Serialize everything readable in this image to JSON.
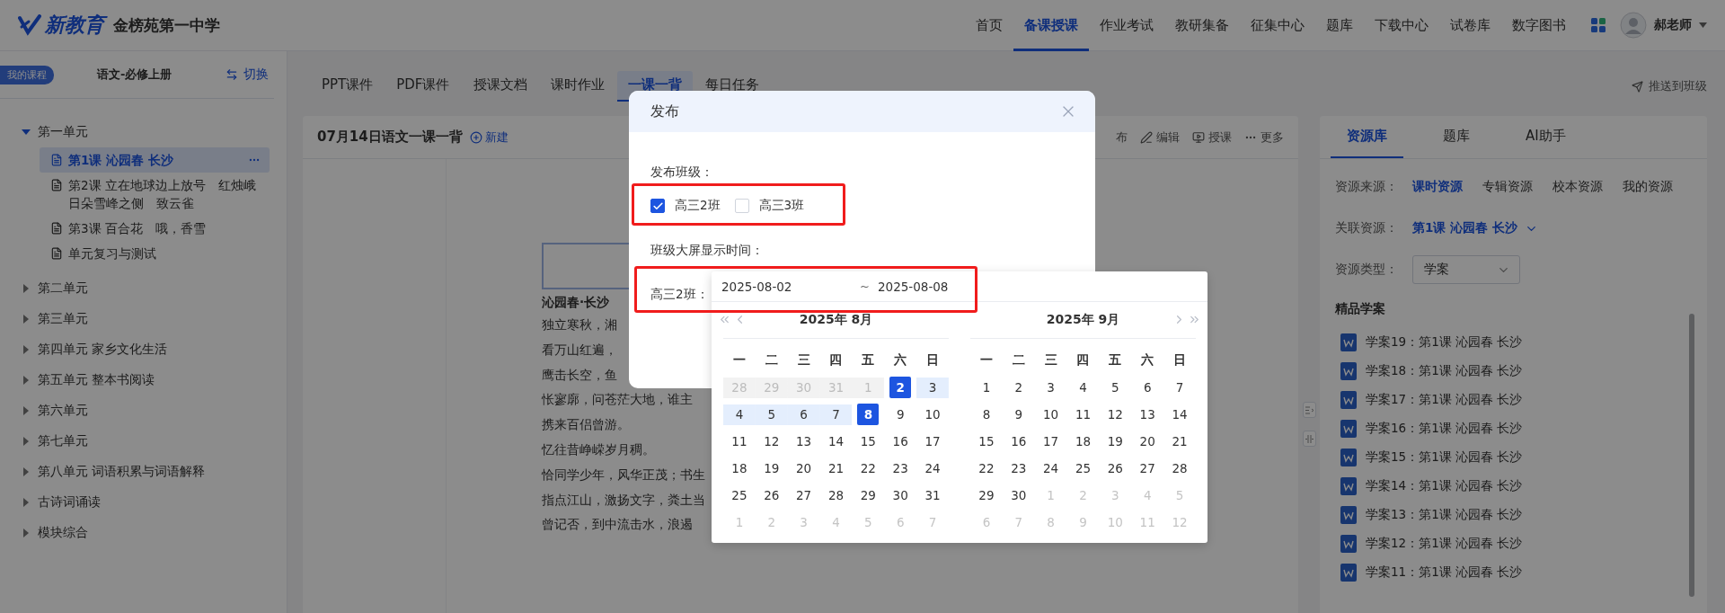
{
  "header": {
    "logo": "新教育",
    "school": "金榜苑第一中学",
    "nav": [
      {
        "label": "首页",
        "selected": false
      },
      {
        "label": "备课授课",
        "selected": true
      },
      {
        "label": "作业考试",
        "selected": false
      },
      {
        "label": "教研集备",
        "selected": false
      },
      {
        "label": "征集中心",
        "selected": false
      },
      {
        "label": "题库",
        "selected": false
      },
      {
        "label": "下载中心",
        "selected": false
      },
      {
        "label": "试卷库",
        "selected": false
      },
      {
        "label": "数字图书",
        "selected": false
      }
    ],
    "user": "郝老师"
  },
  "sidebar": {
    "badge": "我的课程",
    "book": "语文-必修上册",
    "switch": "切换",
    "units": [
      {
        "label": "第一单元",
        "expanded": true,
        "children": [
          {
            "label": "第1课 沁园春 长沙",
            "selected": true
          },
          {
            "label": "第2课 立在地球边上放号　红烛峨日朵雪峰之侧　致云雀",
            "selected": false
          },
          {
            "label": "第3课 百合花　哦，香雪",
            "selected": false
          },
          {
            "label": "单元复习与测试",
            "selected": false
          }
        ]
      },
      {
        "label": "第二单元",
        "expanded": false
      },
      {
        "label": "第三单元",
        "expanded": false
      },
      {
        "label": "第四单元 家乡文化生活",
        "expanded": false
      },
      {
        "label": "第五单元 整本书阅读",
        "expanded": false
      },
      {
        "label": "第六单元",
        "expanded": false
      },
      {
        "label": "第七单元",
        "expanded": false
      },
      {
        "label": "第八单元 词语积累与词语解释",
        "expanded": false
      },
      {
        "label": "古诗词诵读",
        "expanded": false
      },
      {
        "label": "模块综合",
        "expanded": false
      }
    ]
  },
  "tabs": [
    {
      "label": "PPT课件",
      "selected": false
    },
    {
      "label": "PDF课件",
      "selected": false
    },
    {
      "label": "授课文档",
      "selected": false
    },
    {
      "label": "课时作业",
      "selected": false
    },
    {
      "label": "一课一背",
      "selected": true
    },
    {
      "label": "每日任务",
      "selected": false
    }
  ],
  "push": "推送到班级",
  "content": {
    "title": "07月14日语文一课一背",
    "new": "新建",
    "actions": [
      {
        "label": "布",
        "kind": "plain"
      },
      {
        "label": "编辑",
        "kind": "edit"
      },
      {
        "label": "授课",
        "kind": "teach"
      },
      {
        "label": "更多",
        "kind": "more"
      }
    ],
    "poem_title": "沁园春·长沙",
    "poem_lines": [
      "独立寒秋，湘",
      "看万山红遍，",
      "鹰击长空，鱼",
      "怅寥廓，问苍茫大地，谁主",
      "携来百侣曾游。",
      "忆往昔峥嵘岁月稠。",
      "恰同学少年，风华正茂；书生",
      "指点江山，激扬文字，粪土当",
      "曾记否，到中流击水，浪遏"
    ]
  },
  "resources": {
    "tabs": [
      {
        "label": "资源库",
        "selected": true
      },
      {
        "label": "题库",
        "selected": false
      },
      {
        "label": "AI助手",
        "selected": false
      }
    ],
    "source_label": "资源来源：",
    "sources": [
      {
        "label": "课时资源",
        "selected": true
      },
      {
        "label": "专辑资源",
        "selected": false
      },
      {
        "label": "校本资源",
        "selected": false
      },
      {
        "label": "我的资源",
        "selected": false
      }
    ],
    "related_label": "关联资源：",
    "related": "第1课 沁园春 长沙",
    "type_label": "资源类型：",
    "type": "学案",
    "section": "精品学案",
    "items": [
      "学案19：第1课 沁园春 长沙",
      "学案18：第1课 沁园春 长沙",
      "学案17：第1课 沁园春 长沙",
      "学案16：第1课 沁园春 长沙",
      "学案15：第1课 沁园春 长沙",
      "学案14：第1课 沁园春 长沙",
      "学案13：第1课 沁园春 长沙",
      "学案12：第1课 沁园春 长沙",
      "学案11：第1课 沁园春 长沙"
    ]
  },
  "dialog": {
    "title": "发布",
    "classes_label": "发布班级：",
    "classes": [
      {
        "label": "高三2班",
        "checked": true
      },
      {
        "label": "高三3班",
        "checked": false
      }
    ],
    "time_label": "班级大屏显示时间：",
    "row_label": "高三2班："
  },
  "date_picker": {
    "start": "2025-08-02",
    "separator": "~",
    "end": "2025-08-08",
    "months": [
      {
        "title": "2025年 8月",
        "weekdays": [
          "一",
          "二",
          "三",
          "四",
          "五",
          "六",
          "日"
        ],
        "weeks": [
          [
            {
              "d": "28",
              "kind": "disabled"
            },
            {
              "d": "29",
              "kind": "disabled"
            },
            {
              "d": "30",
              "kind": "disabled"
            },
            {
              "d": "31",
              "kind": "disabled"
            },
            {
              "d": "1",
              "kind": "disabled"
            },
            {
              "d": "2",
              "kind": "selected"
            },
            {
              "d": "3",
              "kind": "range"
            }
          ],
          [
            {
              "d": "4",
              "kind": "range"
            },
            {
              "d": "5",
              "kind": "range"
            },
            {
              "d": "6",
              "kind": "range"
            },
            {
              "d": "7",
              "kind": "range"
            },
            {
              "d": "8",
              "kind": "selected"
            },
            {
              "d": "9",
              "kind": "normal"
            },
            {
              "d": "10",
              "kind": "normal"
            }
          ],
          [
            {
              "d": "11",
              "kind": "normal"
            },
            {
              "d": "12",
              "kind": "normal"
            },
            {
              "d": "13",
              "kind": "normal"
            },
            {
              "d": "14",
              "kind": "normal"
            },
            {
              "d": "15",
              "kind": "normal"
            },
            {
              "d": "16",
              "kind": "normal"
            },
            {
              "d": "17",
              "kind": "normal"
            }
          ],
          [
            {
              "d": "18",
              "kind": "normal"
            },
            {
              "d": "19",
              "kind": "normal"
            },
            {
              "d": "20",
              "kind": "normal"
            },
            {
              "d": "21",
              "kind": "normal"
            },
            {
              "d": "22",
              "kind": "normal"
            },
            {
              "d": "23",
              "kind": "normal"
            },
            {
              "d": "24",
              "kind": "normal"
            }
          ],
          [
            {
              "d": "25",
              "kind": "normal"
            },
            {
              "d": "26",
              "kind": "normal"
            },
            {
              "d": "27",
              "kind": "normal"
            },
            {
              "d": "28",
              "kind": "normal"
            },
            {
              "d": "29",
              "kind": "normal"
            },
            {
              "d": "30",
              "kind": "normal"
            },
            {
              "d": "31",
              "kind": "normal"
            }
          ],
          [
            {
              "d": "1",
              "kind": "outside"
            },
            {
              "d": "2",
              "kind": "outside"
            },
            {
              "d": "3",
              "kind": "outside"
            },
            {
              "d": "4",
              "kind": "outside"
            },
            {
              "d": "5",
              "kind": "outside"
            },
            {
              "d": "6",
              "kind": "outside"
            },
            {
              "d": "7",
              "kind": "outside"
            }
          ]
        ]
      },
      {
        "title": "2025年 9月",
        "weekdays": [
          "一",
          "二",
          "三",
          "四",
          "五",
          "六",
          "日"
        ],
        "weeks": [
          [
            {
              "d": "1",
              "kind": "normal"
            },
            {
              "d": "2",
              "kind": "normal"
            },
            {
              "d": "3",
              "kind": "normal"
            },
            {
              "d": "4",
              "kind": "normal"
            },
            {
              "d": "5",
              "kind": "normal"
            },
            {
              "d": "6",
              "kind": "normal"
            },
            {
              "d": "7",
              "kind": "normal"
            }
          ],
          [
            {
              "d": "8",
              "kind": "normal"
            },
            {
              "d": "9",
              "kind": "normal"
            },
            {
              "d": "10",
              "kind": "normal"
            },
            {
              "d": "11",
              "kind": "normal"
            },
            {
              "d": "12",
              "kind": "normal"
            },
            {
              "d": "13",
              "kind": "normal"
            },
            {
              "d": "14",
              "kind": "normal"
            }
          ],
          [
            {
              "d": "15",
              "kind": "normal"
            },
            {
              "d": "16",
              "kind": "normal"
            },
            {
              "d": "17",
              "kind": "normal"
            },
            {
              "d": "18",
              "kind": "normal"
            },
            {
              "d": "19",
              "kind": "normal"
            },
            {
              "d": "20",
              "kind": "normal"
            },
            {
              "d": "21",
              "kind": "normal"
            }
          ],
          [
            {
              "d": "22",
              "kind": "normal"
            },
            {
              "d": "23",
              "kind": "normal"
            },
            {
              "d": "24",
              "kind": "normal"
            },
            {
              "d": "25",
              "kind": "normal"
            },
            {
              "d": "26",
              "kind": "normal"
            },
            {
              "d": "27",
              "kind": "normal"
            },
            {
              "d": "28",
              "kind": "normal"
            }
          ],
          [
            {
              "d": "29",
              "kind": "normal"
            },
            {
              "d": "30",
              "kind": "normal"
            },
            {
              "d": "1",
              "kind": "outside"
            },
            {
              "d": "2",
              "kind": "outside"
            },
            {
              "d": "3",
              "kind": "outside"
            },
            {
              "d": "4",
              "kind": "outside"
            },
            {
              "d": "5",
              "kind": "outside"
            }
          ],
          [
            {
              "d": "6",
              "kind": "outside"
            },
            {
              "d": "7",
              "kind": "outside"
            },
            {
              "d": "8",
              "kind": "outside"
            },
            {
              "d": "9",
              "kind": "outside"
            },
            {
              "d": "10",
              "kind": "outside"
            },
            {
              "d": "11",
              "kind": "outside"
            },
            {
              "d": "12",
              "kind": "outside"
            }
          ]
        ]
      }
    ]
  }
}
